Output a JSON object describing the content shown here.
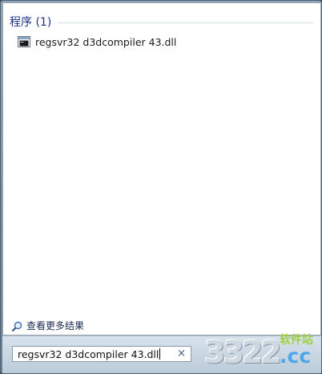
{
  "results": {
    "section_title": "程序 (1)",
    "items": [
      {
        "label": "regsvr32 d3dcompiler 43.dll",
        "icon": "console-window-icon"
      }
    ]
  },
  "see_more": {
    "label": "查看更多结果"
  },
  "search": {
    "value": "regsvr32 d3dcompiler 43.dll",
    "clear_glyph": "×"
  },
  "watermark": {
    "text": "软件站",
    "number": "3322",
    "suffix": ".cc"
  }
}
